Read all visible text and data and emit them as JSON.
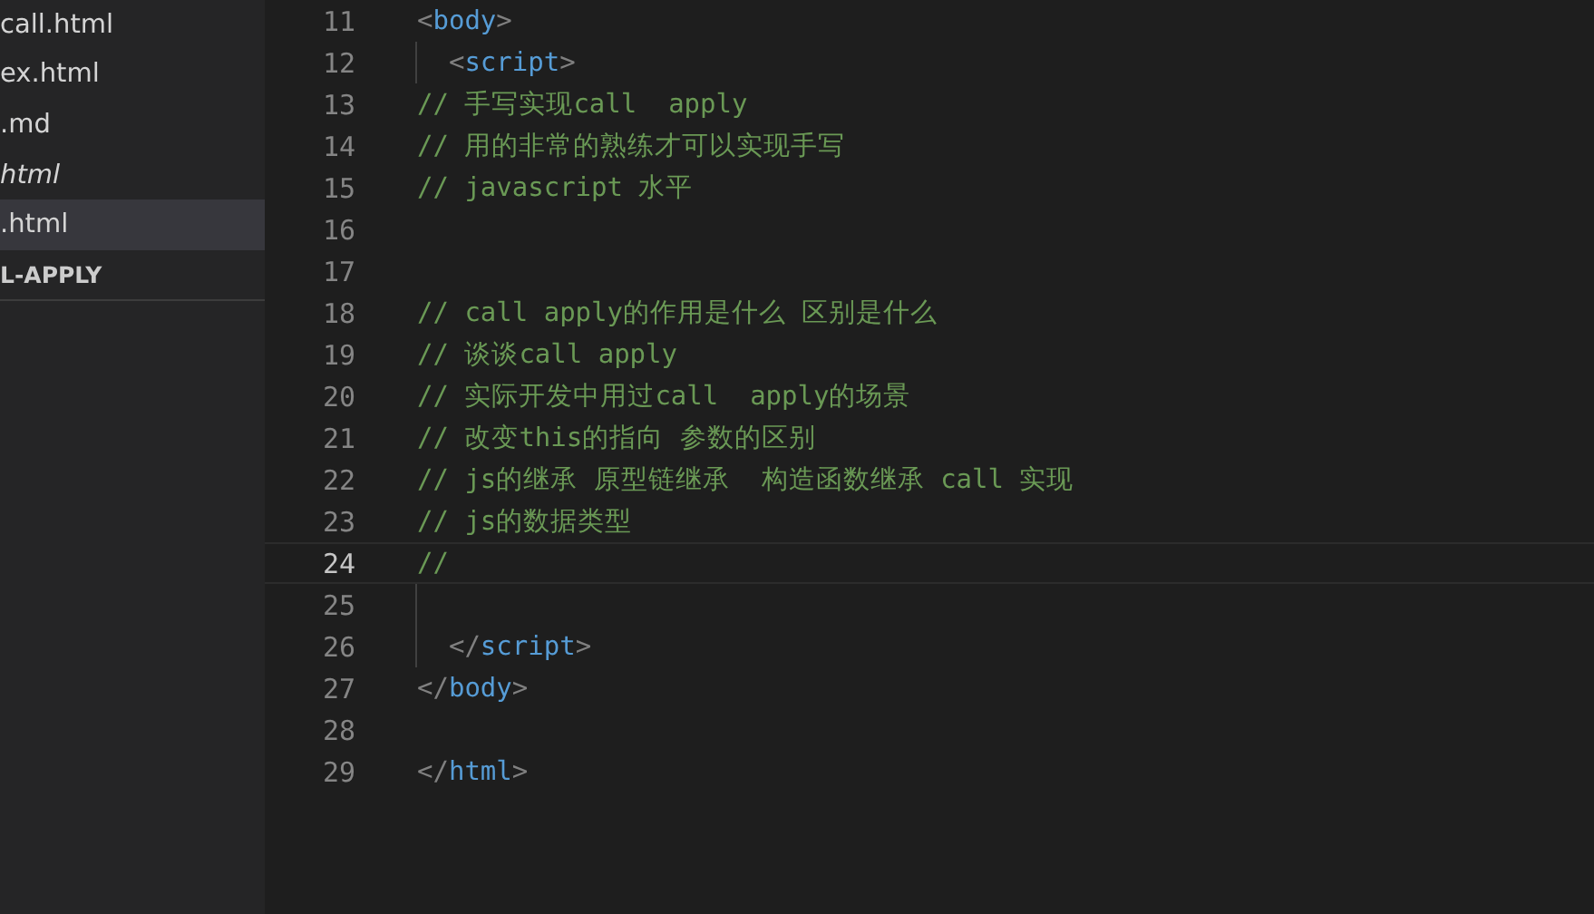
{
  "sidebar": {
    "items": [
      {
        "label": "call.html",
        "selected": false,
        "preview": false
      },
      {
        "label": "ex.html",
        "selected": false,
        "preview": false
      },
      {
        "label": ".md",
        "selected": false,
        "preview": false
      },
      {
        "label": "html",
        "selected": false,
        "preview": true
      },
      {
        "label": ".html",
        "selected": true,
        "preview": false
      }
    ],
    "section_header": "L-APPLY"
  },
  "editor": {
    "lines": [
      {
        "number": "11",
        "current": false,
        "guide": false,
        "tokens": [
          {
            "kind": "punct",
            "text": "<"
          },
          {
            "kind": "tag",
            "text": "body"
          },
          {
            "kind": "punct",
            "text": ">"
          }
        ]
      },
      {
        "number": "12",
        "current": false,
        "guide": true,
        "tokens": [
          {
            "kind": "punct",
            "text": "  <"
          },
          {
            "kind": "tag",
            "text": "script"
          },
          {
            "kind": "punct",
            "text": ">"
          }
        ]
      },
      {
        "number": "13",
        "current": false,
        "guide": false,
        "tokens": [
          {
            "kind": "comment",
            "text": "// 手写实现call  apply"
          }
        ]
      },
      {
        "number": "14",
        "current": false,
        "guide": false,
        "tokens": [
          {
            "kind": "comment",
            "text": "// 用的非常的熟练才可以实现手写"
          }
        ]
      },
      {
        "number": "15",
        "current": false,
        "guide": false,
        "tokens": [
          {
            "kind": "comment",
            "text": "// javascript 水平"
          }
        ]
      },
      {
        "number": "16",
        "current": false,
        "guide": false
      },
      {
        "number": "17",
        "current": false,
        "guide": false
      },
      {
        "number": "18",
        "current": false,
        "guide": false,
        "tokens": [
          {
            "kind": "comment",
            "text": "// call apply的作用是什么 区别是什么"
          }
        ]
      },
      {
        "number": "19",
        "current": false,
        "guide": false,
        "tokens": [
          {
            "kind": "comment",
            "text": "// 谈谈call apply"
          }
        ]
      },
      {
        "number": "20",
        "current": false,
        "guide": false,
        "tokens": [
          {
            "kind": "comment",
            "text": "// 实际开发中用过call  apply的场景"
          }
        ]
      },
      {
        "number": "21",
        "current": false,
        "guide": false,
        "tokens": [
          {
            "kind": "comment",
            "text": "// 改变this的指向 参数的区别"
          }
        ]
      },
      {
        "number": "22",
        "current": false,
        "guide": false,
        "tokens": [
          {
            "kind": "comment",
            "text": "// js的继承 原型链继承  构造函数继承 call 实现"
          }
        ]
      },
      {
        "number": "23",
        "current": false,
        "guide": false,
        "tokens": [
          {
            "kind": "comment",
            "text": "// js的数据类型"
          }
        ]
      },
      {
        "number": "24",
        "current": true,
        "guide": false,
        "tokens": [
          {
            "kind": "comment",
            "text": "//"
          }
        ]
      },
      {
        "number": "25",
        "current": false,
        "guide": true
      },
      {
        "number": "26",
        "current": false,
        "guide": true,
        "tokens": [
          {
            "kind": "punct",
            "text": "  </"
          },
          {
            "kind": "tag",
            "text": "script"
          },
          {
            "kind": "punct",
            "text": ">"
          }
        ]
      },
      {
        "number": "27",
        "current": false,
        "guide": false,
        "tokens": [
          {
            "kind": "punct",
            "text": "</"
          },
          {
            "kind": "tag",
            "text": "body"
          },
          {
            "kind": "punct",
            "text": ">"
          }
        ]
      },
      {
        "number": "28",
        "current": false,
        "guide": false
      },
      {
        "number": "29",
        "current": false,
        "guide": false,
        "tokens": [
          {
            "kind": "punct",
            "text": "</"
          },
          {
            "kind": "tag",
            "text": "html"
          },
          {
            "kind": "punct",
            "text": ">"
          }
        ]
      }
    ]
  }
}
